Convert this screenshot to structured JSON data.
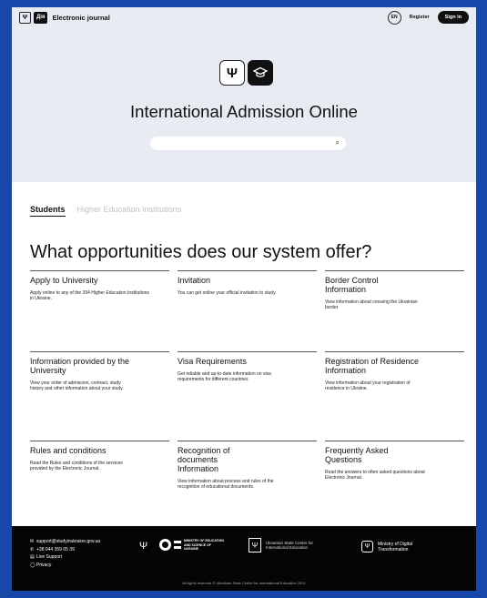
{
  "header": {
    "brand": "Electronic journal",
    "lang": "EN",
    "register": "Register",
    "sign_in": "Sign in",
    "trident_glyph": "Ψ",
    "dia_logo": "Дія"
  },
  "hero": {
    "title": "International Admission Online",
    "search_placeholder": "",
    "search_icon": "⌕",
    "logo_left": "Ψ",
    "logo_right": "🎓"
  },
  "tabs": {
    "active": "Students",
    "inactive": "Higher Education Institutions"
  },
  "heading": "What opportunities does our system offer?",
  "cards": [
    {
      "title": "Apply to University",
      "desc": "Apply online to any of the 394 Higher Education Institutions in Ukraine."
    },
    {
      "title": "Invitation",
      "desc": "You can get online your official invitation to study."
    },
    {
      "title": "Border Control Information",
      "desc": "View information about crossing the Ukrainian border"
    },
    {
      "title": "Information provided by the University",
      "desc": "View your order of admission, contract, study history and other information about your study."
    },
    {
      "title": "Visa Requirements",
      "desc": "Get reliable and up-to-date information on visa requirements for different countries"
    },
    {
      "title": "Registration of Residence Information",
      "desc": "View information about your registration of residence in Ukraine."
    },
    {
      "title": "Rules and conditions",
      "desc": "Read the Rules and conditions of the services provided by the Electronic Journal."
    },
    {
      "title": "Recognition of documents Information",
      "desc": "View information about process and rules of the recognition of educational documents."
    },
    {
      "title": "Frequently Asked Questions",
      "desc": "Read the answers to often asked questions about Electronic Journal."
    }
  ],
  "footer": {
    "email": "support@studyinukraine.gov.ua",
    "phone": "+38 044 359 05 39",
    "live_support": "Live Support",
    "privacy": "Privacy",
    "mon_text": "MINISTRY OF EDUCATION AND SCIENCE OF UKRAINE",
    "center_text": "Ukrainian State Center for International Education",
    "mdt_text": "Ministry of Digital Transformation",
    "rights": "All rights reserved © Ukrainian State Center for International Education 2021"
  }
}
